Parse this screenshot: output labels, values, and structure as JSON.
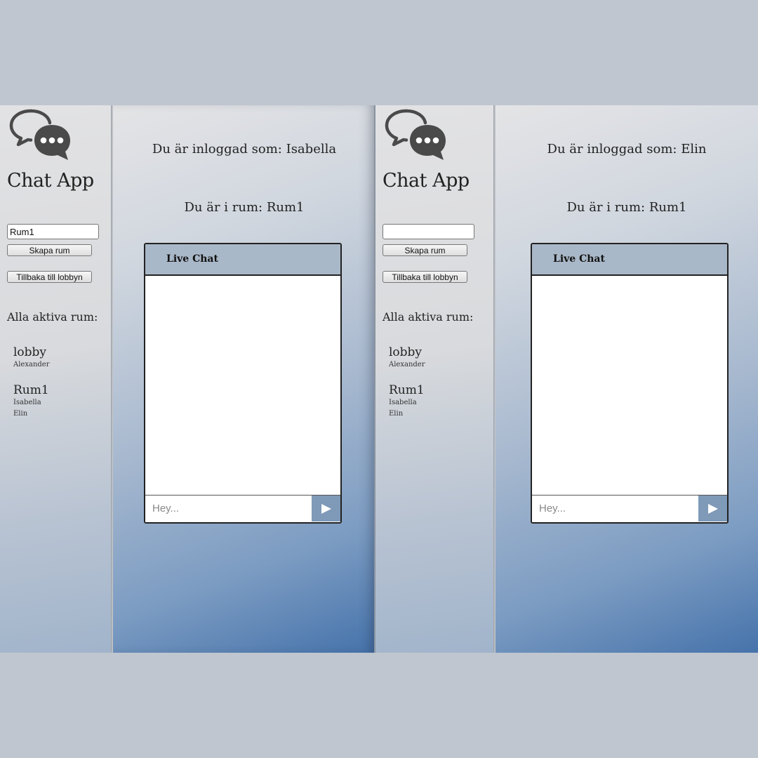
{
  "screens": [
    {
      "app_title": "Chat App",
      "room_input": {
        "value": "Rum1",
        "placeholder": ""
      },
      "create_room_label": "Skapa rum",
      "back_to_lobby_label": "Tillbaka till lobbyn",
      "active_rooms_heading": "Alla aktiva rum:",
      "rooms": [
        {
          "name": "lobby",
          "users": [
            "Alexander"
          ]
        },
        {
          "name": "Rum1",
          "users": [
            "Isabella",
            "Elin"
          ]
        }
      ],
      "logged_in_text": "Du är inloggad som: Isabella",
      "current_room_text": "Du är i rum: Rum1",
      "chat_title": "Live Chat",
      "message_placeholder": "Hey...",
      "send_icon": "play-triangle-icon"
    },
    {
      "app_title": "Chat App",
      "room_input": {
        "value": "",
        "placeholder": ""
      },
      "create_room_label": "Skapa rum",
      "back_to_lobby_label": "Tillbaka till lobbyn",
      "active_rooms_heading": "Alla aktiva rum:",
      "rooms": [
        {
          "name": "lobby",
          "users": [
            "Alexander"
          ]
        },
        {
          "name": "Rum1",
          "users": [
            "Isabella",
            "Elin"
          ]
        }
      ],
      "logged_in_text": "Du är inloggad som: Elin",
      "current_room_text": "Du är i rum: Rum1",
      "chat_title": "Live Chat",
      "message_placeholder": "Hey...",
      "send_icon": "play-triangle-icon"
    }
  ],
  "colors": {
    "page_background": "#bfc6cf",
    "chat_header": "#a9b8c8",
    "send_button": "#7f99b8",
    "logo_icon": "#4a4a4a"
  }
}
